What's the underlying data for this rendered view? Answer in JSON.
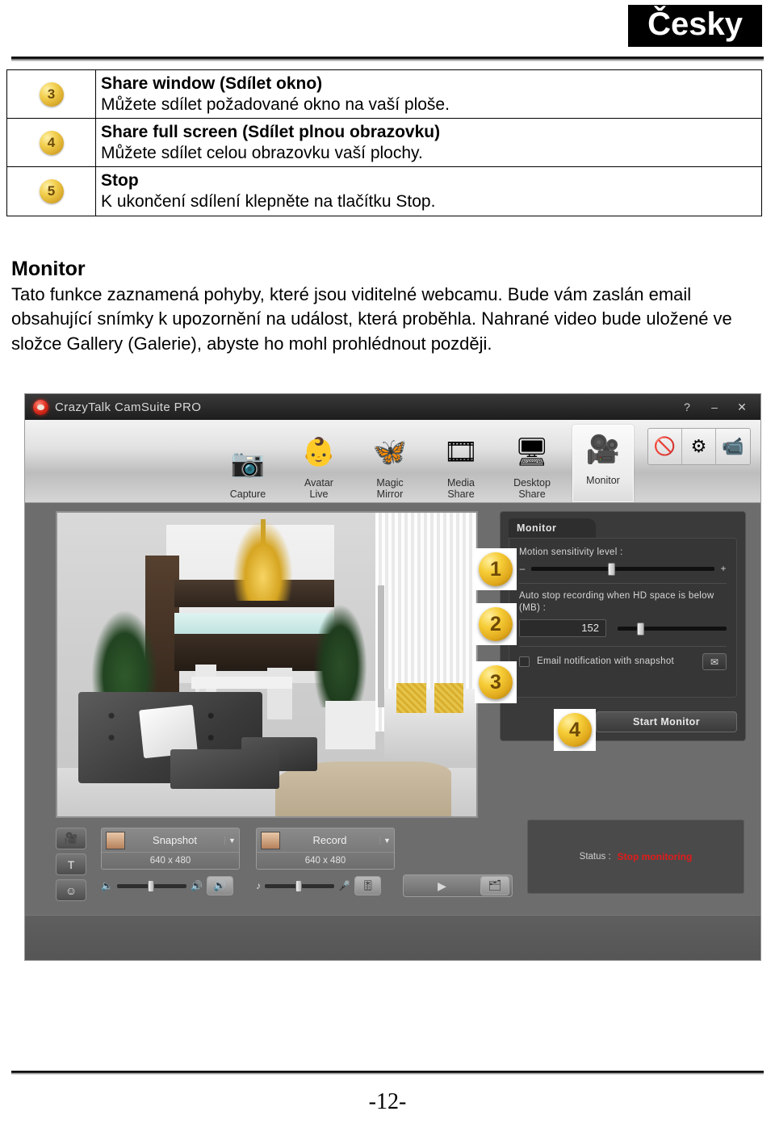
{
  "header": {
    "language_badge": "Česky"
  },
  "feature_table": {
    "rows": [
      {
        "badge": "3",
        "title": "Share window (Sdílet okno)",
        "desc": "Můžete sdílet požadované okno na vaší ploše."
      },
      {
        "badge": "4",
        "title": "Share full screen (Sdílet plnou obrazovku)",
        "desc": "Můžete sdílet celou obrazovku vaší plochy."
      },
      {
        "badge": "5",
        "title": "Stop",
        "desc": "K ukončení sdílení klepněte na tlačítku Stop."
      }
    ]
  },
  "section": {
    "heading": "Monitor",
    "paragraph": "Tato funkce zaznamená pohyby, které jsou viditelné webcamu. Bude vám zaslán email obsahující snímky k upozornění na událost, která proběhla. Nahrané video bude uložené ve složce Gallery (Galerie), abyste ho mohl prohlédnout později."
  },
  "app": {
    "title": "CrazyTalk CamSuite PRO",
    "logo_icon": "app-logo-icon",
    "window_buttons": [
      {
        "name": "help-button",
        "glyph": "?"
      },
      {
        "name": "minimize-button",
        "glyph": "–"
      },
      {
        "name": "close-button",
        "glyph": "✕"
      }
    ],
    "toolbar": {
      "items": [
        {
          "label_line1": "Capture",
          "label_line2": "",
          "icon": "camera-icon",
          "glyph": "📷",
          "active": false
        },
        {
          "label_line1": "Avatar",
          "label_line2": "Live",
          "icon": "avatar-face-icon",
          "glyph": "👶",
          "active": false
        },
        {
          "label_line1": "Magic",
          "label_line2": "Mirror",
          "icon": "mask-icon",
          "glyph": "🦋",
          "active": false
        },
        {
          "label_line1": "Media",
          "label_line2": "Share",
          "icon": "film-reel-icon",
          "glyph": "🎞",
          "active": false
        },
        {
          "label_line1": "Desktop",
          "label_line2": "Share",
          "icon": "monitor-icon",
          "glyph": "🖥",
          "active": false
        },
        {
          "label_line1": "Monitor",
          "label_line2": "",
          "icon": "webcam-icon",
          "glyph": "🎥",
          "active": true
        }
      ],
      "right_buttons": [
        {
          "name": "disable-webcam-button",
          "icon": "no-webcam-icon",
          "glyph": "🚫"
        },
        {
          "name": "settings-button",
          "icon": "gear-icon",
          "glyph": "⚙"
        },
        {
          "name": "camera-select-button",
          "icon": "camcorder-icon",
          "glyph": "📹"
        }
      ]
    },
    "preview": {
      "name": "webcam-preview",
      "alt": "living-room-scene"
    },
    "monitor_panel": {
      "tab_label": "Monitor",
      "sensitivity": {
        "label": "Motion sensitivity level :",
        "minus": "–",
        "plus": "+",
        "value_pct": 44
      },
      "hd_space": {
        "label": "Auto stop recording when HD space is below (MB) :",
        "value": "152",
        "slider_pct": 20
      },
      "email_notification": {
        "label": "Email notification with snapshot",
        "checked": false,
        "mail_icon": "envelope-icon",
        "mail_glyph": "✉"
      },
      "start_button": "Start Monitor",
      "callouts": [
        "1",
        "2",
        "3",
        "4"
      ]
    },
    "left_tools": [
      {
        "name": "video-source-button",
        "icon": "video-camera-icon",
        "glyph": "🎥"
      },
      {
        "name": "text-overlay-button",
        "icon": "text-pen-icon",
        "glyph": "T"
      },
      {
        "name": "emoticon-button",
        "icon": "emoticon-icon",
        "glyph": "☺"
      }
    ],
    "capture_groups": [
      {
        "name": "snapshot-group",
        "label": "Snapshot",
        "resolution": "640 x 480",
        "dropdown_glyph": "▼",
        "thumb_icon": "face-thumbnail-icon"
      },
      {
        "name": "record-group",
        "label": "Record",
        "resolution": "640 x 480",
        "dropdown_glyph": "▼",
        "thumb_icon": "face-thumbnail-icon"
      }
    ],
    "mini_sliders": [
      {
        "name": "speaker-volume-slider",
        "left_icon": "speaker-low-icon",
        "left_glyph": "🔈",
        "right_icon": "speaker-high-icon",
        "right_glyph": "🔊",
        "button_icon": "speaker-mute-button",
        "button_glyph": "🔊"
      },
      {
        "name": "microphone-volume-slider",
        "left_icon": "music-note-icon",
        "left_glyph": "♪",
        "right_icon": "microphone-icon",
        "right_glyph": "🎤",
        "button_icon": "audio-settings-button",
        "button_glyph": "🎚"
      }
    ],
    "playback": {
      "play_glyph": "▶",
      "gallery_glyph": "🗂"
    },
    "status": {
      "label": "Status :",
      "value": "Stop monitoring",
      "value_color": "#e21b1b"
    }
  },
  "footer": {
    "page_number": "-12-"
  }
}
